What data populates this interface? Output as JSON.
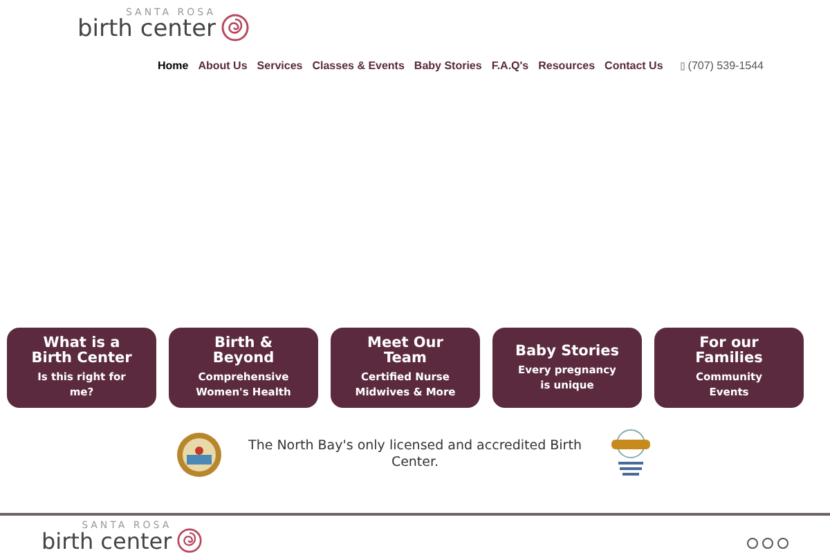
{
  "header": {
    "logo": {
      "small": "SANTA ROSA",
      "large": "birth center"
    },
    "nav": [
      {
        "label": "Home",
        "selected": true
      },
      {
        "label": "About Us",
        "selected": false
      },
      {
        "label": "Services",
        "selected": false
      },
      {
        "label": "Classes & Events",
        "selected": false
      },
      {
        "label": "Baby Stories",
        "selected": false
      },
      {
        "label": "F.A.Q's",
        "selected": false
      },
      {
        "label": "Resources",
        "selected": false
      },
      {
        "label": "Contact Us",
        "selected": false
      }
    ],
    "phone": "(707) 539-1544"
  },
  "cards": [
    {
      "title": "What is a Birth Center",
      "subtitle": "Is this right for me?"
    },
    {
      "title": "Birth & Beyond",
      "subtitle": "Comprehensive Women's Health"
    },
    {
      "title": "Meet Our Team",
      "subtitle": "Certified Nurse Midwives & More"
    },
    {
      "title": "Baby Stories",
      "subtitle": "Every pregnancy is unique"
    },
    {
      "title": "For our Families",
      "subtitle": "Community Events"
    }
  ],
  "tagline": "The North Bay's only licensed and accredited Birth Center.",
  "footer": {
    "logo": {
      "small": "SANTA ROSA",
      "large": "birth center"
    }
  }
}
